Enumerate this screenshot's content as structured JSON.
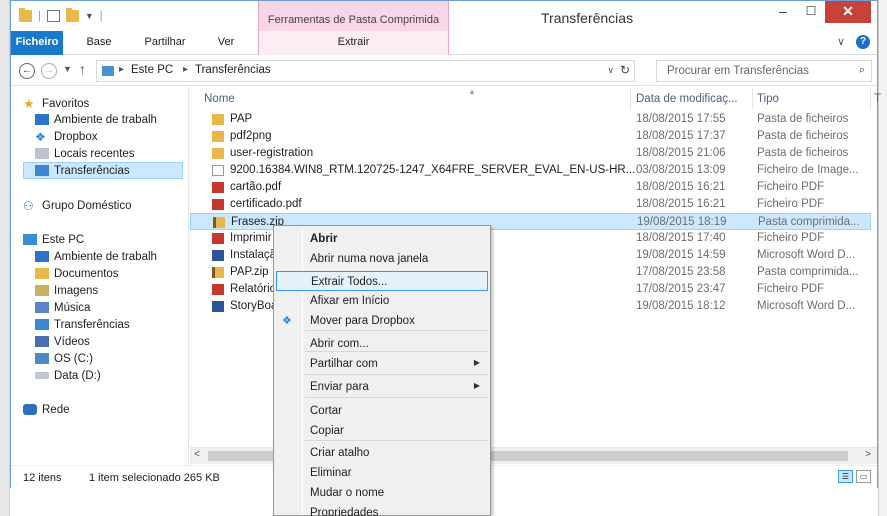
{
  "window": {
    "title": "Transferências",
    "tools_tab": "Ferramentas de Pasta Comprimida"
  },
  "ribbon": {
    "tabs": [
      "Ficheiro",
      "Base",
      "Partilhar",
      "Ver"
    ],
    "context_tab": "Extrair"
  },
  "address": {
    "crumbs": [
      "Este PC",
      "Transferências"
    ],
    "search_placeholder": "Procurar em Transferências"
  },
  "nav": {
    "favorites": "Favoritos",
    "fav_items": [
      "Ambiente de trabalh",
      "Dropbox",
      "Locais recentes",
      "Transferências"
    ],
    "homegroup": "Grupo Doméstico",
    "this_pc": "Este PC",
    "pc_items": [
      "Ambiente de trabalh",
      "Documentos",
      "Imagens",
      "Música",
      "Transferências",
      "Vídeos",
      "OS (C:)",
      "Data (D:)"
    ],
    "network": "Rede"
  },
  "columns": {
    "name": "Nome",
    "date": "Data de modificaç...",
    "type": "Tipo",
    "extra": "T"
  },
  "files": [
    {
      "name": "PAP",
      "date": "18/08/2015 17:55",
      "type": "Pasta de ficheiros",
      "icon": "folder-icon"
    },
    {
      "name": "pdf2png",
      "date": "18/08/2015 17:37",
      "type": "Pasta de ficheiros",
      "icon": "folder-icon"
    },
    {
      "name": "user-registration",
      "date": "18/08/2015 21:06",
      "type": "Pasta de ficheiros",
      "icon": "folder-icon"
    },
    {
      "name": "9200.16384.WIN8_RTM.120725-1247_X64FRE_SERVER_EVAL_EN-US-HR...",
      "date": "03/08/2015 13:09",
      "type": "Ficheiro de Image...",
      "icon": "disc-image-icon"
    },
    {
      "name": "cartão.pdf",
      "date": "18/08/2015 16:21",
      "type": "Ficheiro PDF",
      "icon": "pdf-icon"
    },
    {
      "name": "certificado.pdf",
      "date": "18/08/2015 16:21",
      "type": "Ficheiro PDF",
      "icon": "pdf-icon"
    },
    {
      "name": "Frases.zip",
      "date": "19/08/2015 18:19",
      "type": "Pasta comprimida...",
      "icon": "zip-icon"
    },
    {
      "name": "Imprimir",
      "date": "18/08/2015 17:40",
      "type": "Ficheiro PDF",
      "icon": "pdf-icon"
    },
    {
      "name": "Instalação",
      "date": "19/08/2015 14:59",
      "type": "Microsoft Word D...",
      "icon": "word-icon"
    },
    {
      "name": "PAP.zip",
      "date": "17/08/2015 23:58",
      "type": "Pasta comprimida...",
      "icon": "zip-icon"
    },
    {
      "name": "Relatório",
      "date": "17/08/2015 23:47",
      "type": "Ficheiro PDF",
      "icon": "pdf-icon"
    },
    {
      "name": "StoryBoa",
      "date": "19/08/2015 18:12",
      "type": "Microsoft Word D...",
      "icon": "word-icon"
    }
  ],
  "status": {
    "count": "12 itens",
    "selection": "1 item selecionado 265 KB"
  },
  "context_menu": {
    "items": [
      {
        "label": "Abrir",
        "bold": true
      },
      {
        "label": "Abrir numa nova janela"
      },
      {
        "label": "Extrair Todos...",
        "highlight": true
      },
      {
        "label": "Afixar em Início"
      },
      {
        "label": "Mover para Dropbox",
        "icon": "dropbox-icon"
      },
      {
        "label": "Abrir com..."
      },
      {
        "label": "Partilhar com",
        "submenu": true
      },
      {
        "label": "Enviar para",
        "submenu": true
      },
      {
        "label": "Cortar"
      },
      {
        "label": "Copiar"
      },
      {
        "label": "Criar atalho"
      },
      {
        "label": "Eliminar"
      },
      {
        "label": "Mudar o nome"
      },
      {
        "label": "Propriedades"
      }
    ]
  },
  "colors": {
    "accent": "#1979ca",
    "selection": "#cce8ff",
    "tools_tab": "#f9d6e6"
  }
}
